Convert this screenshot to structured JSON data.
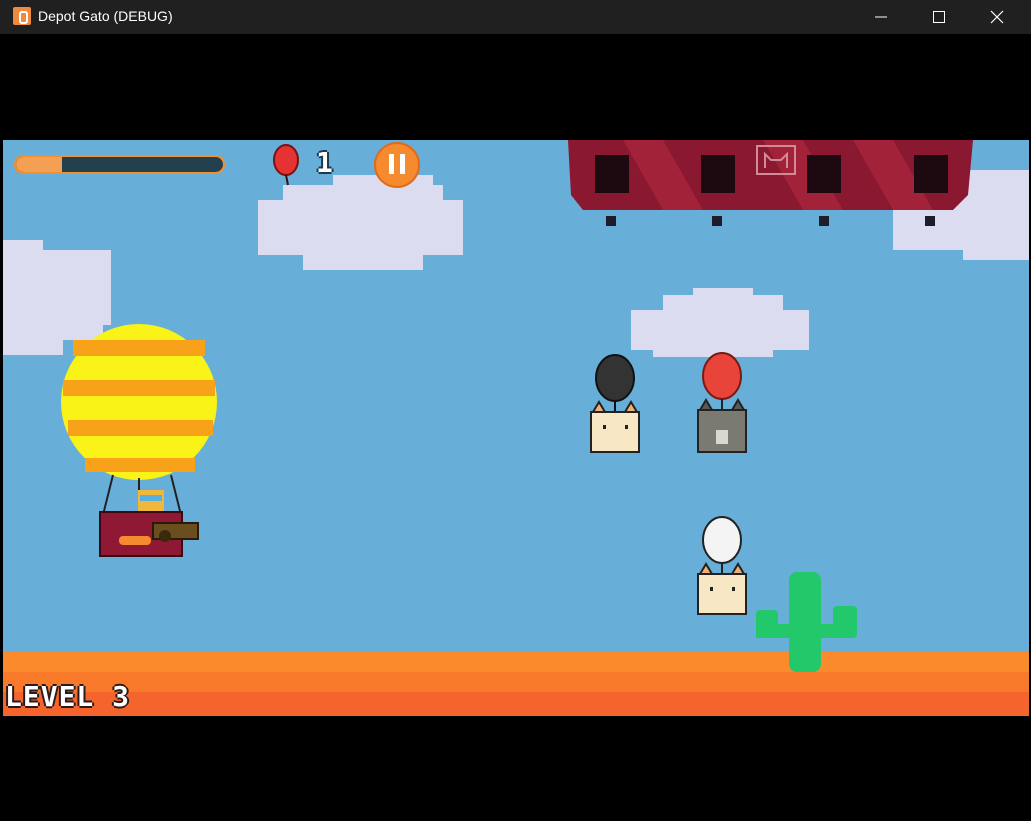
{
  "window": {
    "title": "Depot Gato (DEBUG)"
  },
  "hud": {
    "progress_fraction": 0.22,
    "balloon_count": "1"
  },
  "level": {
    "label": "LEVEL 3"
  },
  "colors": {
    "sky": "#67aed8",
    "ground": "#fb8a2c",
    "airship": "#8a1830",
    "pause_button": "#f58a2f",
    "accent_bar": "#f3a054"
  },
  "icons": {
    "app": "cat-app-icon",
    "pause": "pause-icon",
    "balloon": "red-balloon-icon"
  }
}
